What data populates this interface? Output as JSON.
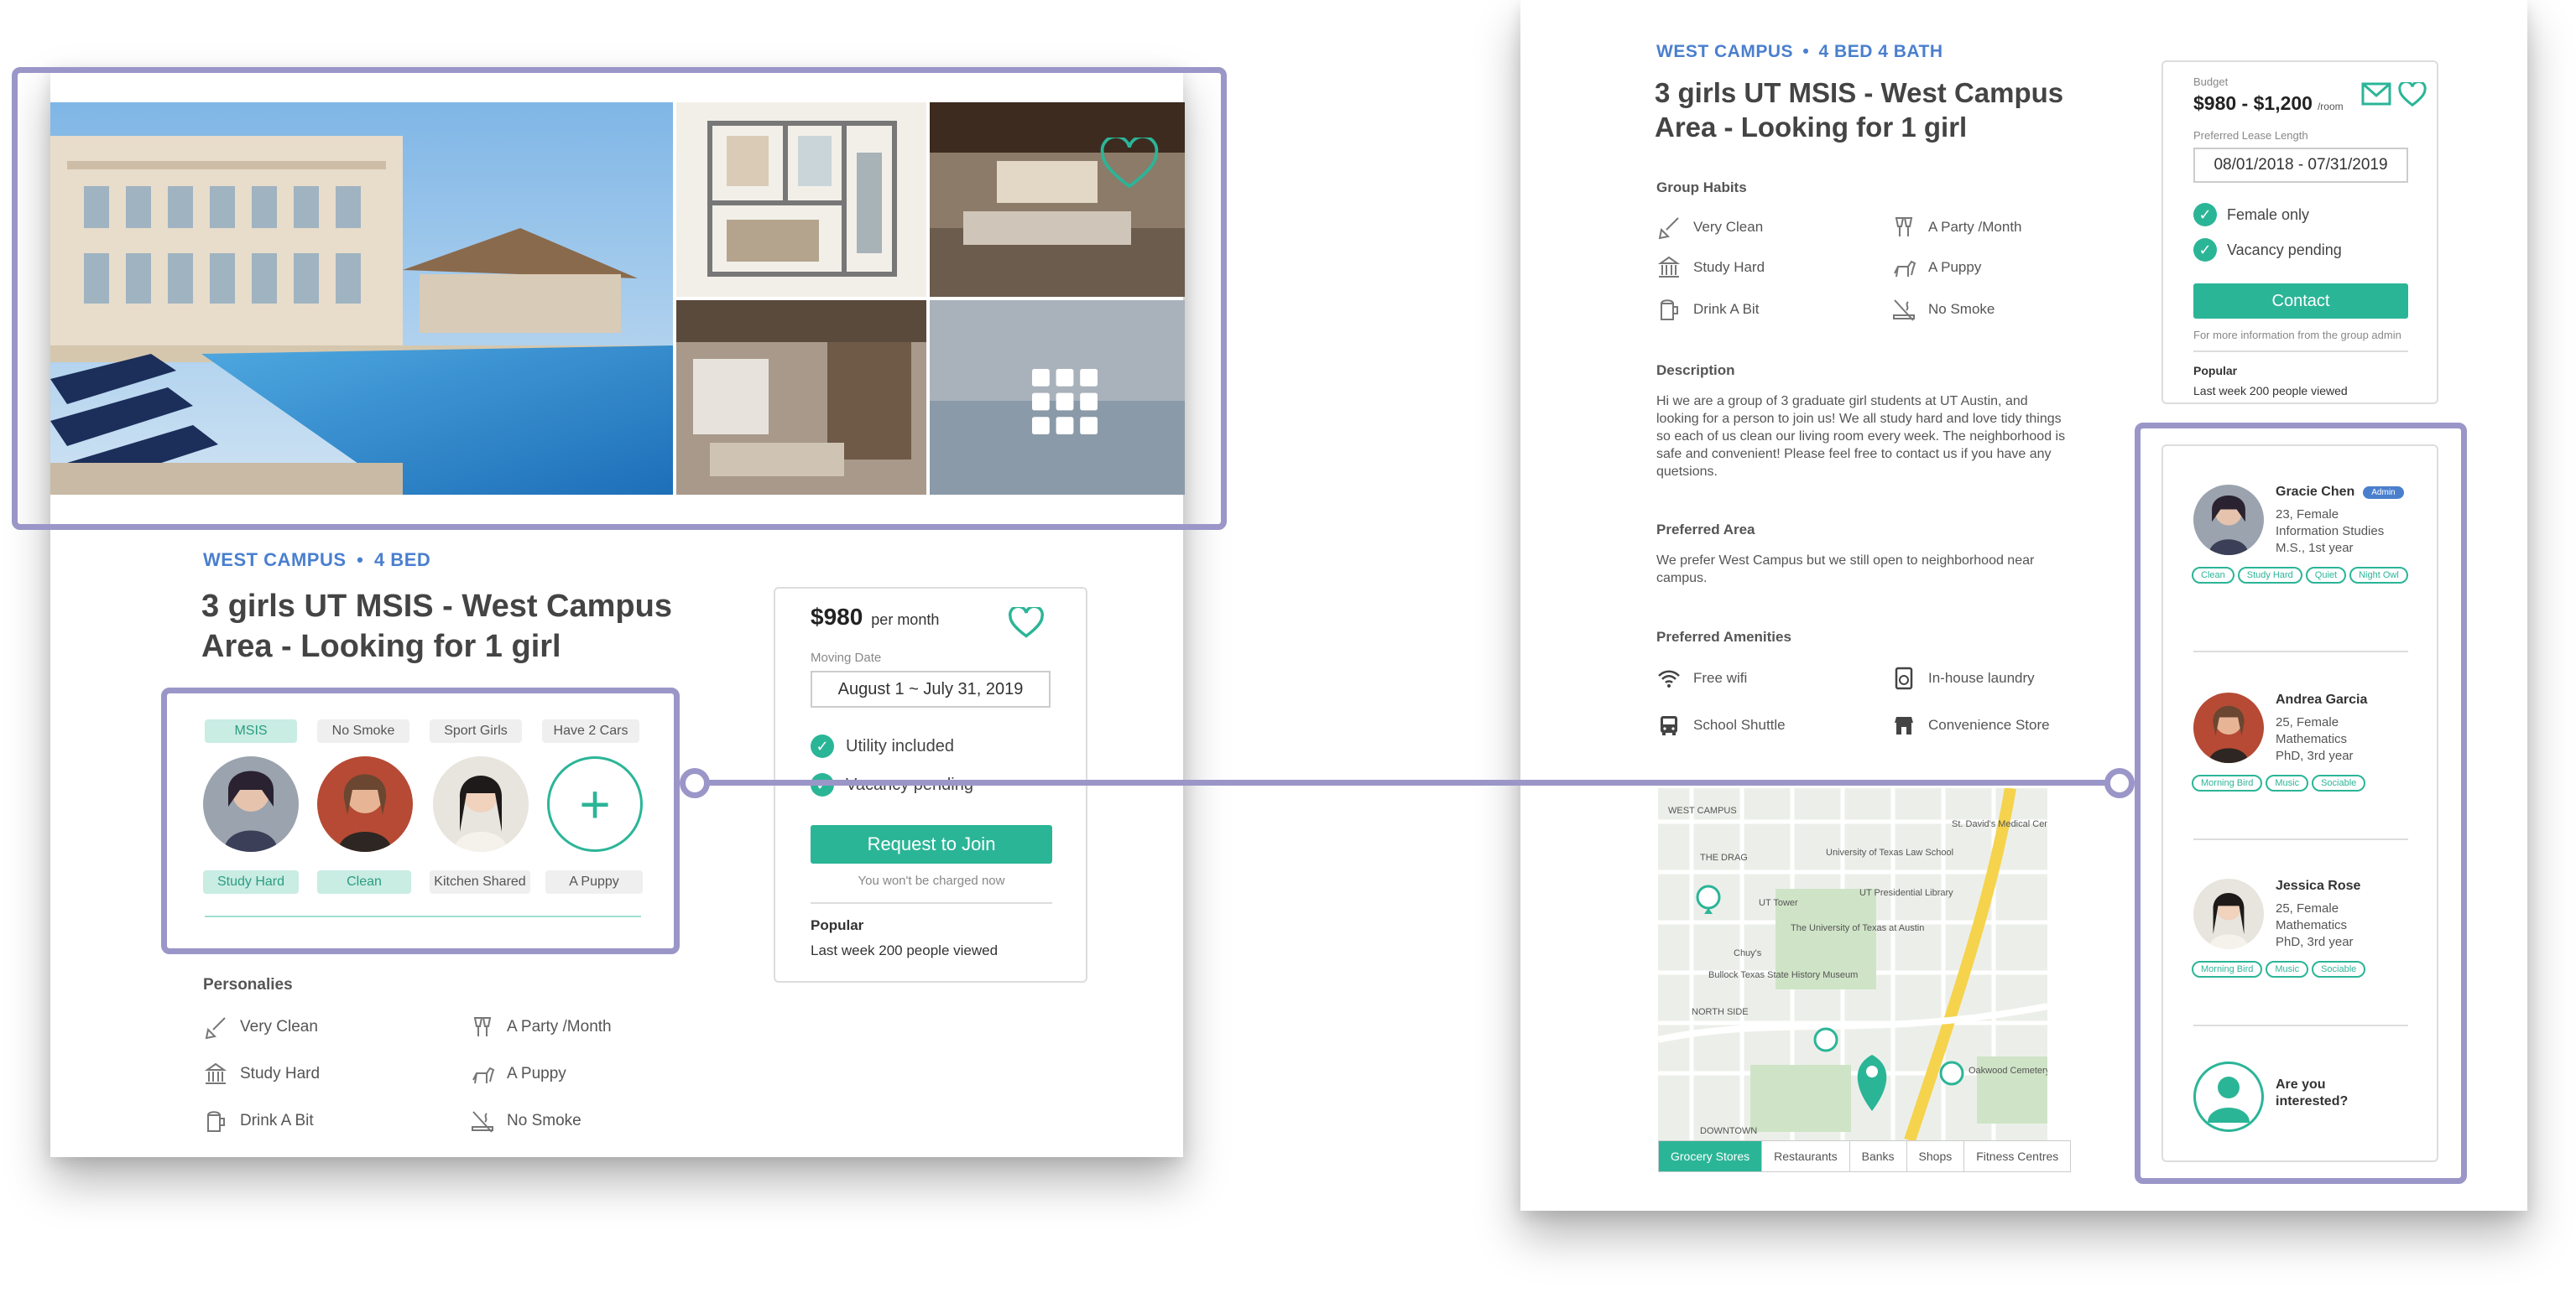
{
  "left": {
    "location": "WEST CAMPUS",
    "bed": "4 BED",
    "title_line1": "3 girls UT MSIS - West Campus",
    "title_line2": "Area - Looking for 1 girl",
    "top_tags": [
      "MSIS",
      "No Smoke",
      "Sport Girls",
      "Have 2 Cars"
    ],
    "bottom_tags": [
      "Study Hard",
      "Clean",
      "Kitchen Shared",
      "A Puppy"
    ],
    "price": "$980",
    "price_unit": "per month",
    "moving_date_label": "Moving Date",
    "moving_date_value": "August 1 ~ July 31, 2019",
    "check1": "Utility included",
    "check2": "Vacancy pending",
    "join_button": "Request to Join",
    "charge_note": "You won't be charged now",
    "popular_title": "Popular",
    "popular_text": "Last week 200 people viewed",
    "personalities_title": "Personalies",
    "habits": [
      "Very Clean",
      "A Party /Month",
      "Study Hard",
      "A Puppy",
      "Drink A Bit",
      "No Smoke"
    ]
  },
  "right": {
    "location": "WEST CAMPUS",
    "bedbath": "4 BED 4 BATH",
    "title_line1": "3 girls UT MSIS - West Campus",
    "title_line2": "Area - Looking for 1 girl",
    "group_habits_title": "Group Habits",
    "habits": [
      "Very Clean",
      "A Party /Month",
      "Study Hard",
      "A Puppy",
      "Drink A Bit",
      "No Smoke"
    ],
    "description_title": "Description",
    "description": "Hi we are a group of 3 graduate girl students at UT Austin, and looking for a person to join us! We all study hard and love tidy things so each of us clean our living room every week. The neighborhood is safe and convenient! Please feel free to contact us if you have any quetsions.",
    "preferred_area_title": "Preferred Area",
    "preferred_area": "We prefer West Campus but we still open to neighborhood near campus.",
    "amenities_title": "Preferred Amenities",
    "amenities": [
      "Free wifi",
      "In-house laundry",
      "School Shuttle",
      "Convenience Store"
    ],
    "map_tabs": [
      "Grocery Stores",
      "Restaurants",
      "Banks",
      "Shops",
      "Fitness Centres"
    ],
    "map_labels": [
      "WEST CAMPUS",
      "THE DRAG",
      "The University of Texas at Austin",
      "NORTH SIDE",
      "DOWNTOWN",
      "UT Tower",
      "University of Texas Law School",
      "UT Presidential Library",
      "Bullock Texas State History Museum",
      "Oakwood Cemetery",
      "St. David's Medical Center",
      "Chuy's"
    ],
    "budget_label": "Budget",
    "budget_value": "$980 - $1,200",
    "budget_unit": "/room",
    "lease_label": "Preferred Lease Length",
    "lease_value": "08/01/2018 - 07/31/2019",
    "check1": "Female only",
    "check2": "Vacancy pending",
    "contact_button": "Contact",
    "contact_note": "For more information from the group admin",
    "popular_title": "Popular",
    "popular_text": "Last week 200 people viewed",
    "members": [
      {
        "name": "Gracie Chen",
        "badge": "Admin",
        "line1": "23, Female",
        "line2": "Information Studies",
        "line3": "M.S., 1st year",
        "tags": [
          "Clean",
          "Study Hard",
          "Quiet",
          "Night Owl"
        ]
      },
      {
        "name": "Andrea Garcia",
        "line1": "25, Female",
        "line2": "Mathematics",
        "line3": "PhD, 3rd year",
        "tags": [
          "Morning Bird",
          "Music",
          "Sociable"
        ]
      },
      {
        "name": "Jessica Rose",
        "line1": "25, Female",
        "line2": "Mathematics",
        "line3": "PhD, 3rd year",
        "tags": [
          "Morning Bird",
          "Music",
          "Sociable"
        ]
      }
    ],
    "interested_line1": "Are you",
    "interested_line2": "interested?"
  },
  "colors": {
    "accent": "#2bb597",
    "highlight": "#9b96c8",
    "eyebrow": "#4a7fce"
  }
}
